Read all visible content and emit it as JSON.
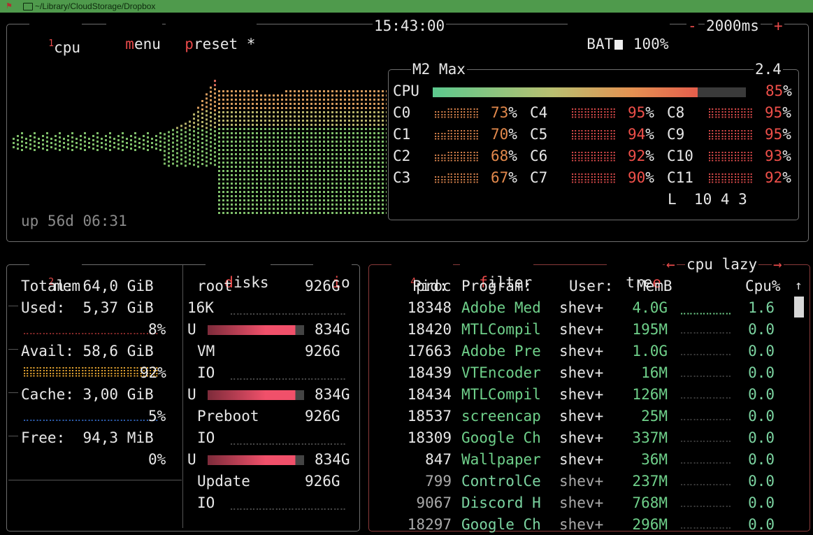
{
  "titlebar": {
    "path": "~/Library/CloudStorage/Dropbox"
  },
  "cpu": {
    "num": "1",
    "label": "cpu",
    "menu_first": "m",
    "menu_rest": "enu",
    "preset_first": "p",
    "preset_rest": "reset *",
    "clock": "15:43:00",
    "battery": "BAT",
    "battery_pct": "100%",
    "minus": "-",
    "interval": "2000ms",
    "plus": "+",
    "uptime": "up 56d 06:31",
    "model": "M2 Max",
    "freq": "2.4",
    "total_label": "CPU",
    "total_pct": "85",
    "total_fraction": 0.85,
    "cores": [
      {
        "name": "C0",
        "pct": "73",
        "level": "o"
      },
      {
        "name": "C1",
        "pct": "70",
        "level": "o"
      },
      {
        "name": "C2",
        "pct": "68",
        "level": "o"
      },
      {
        "name": "C3",
        "pct": "67",
        "level": "o"
      },
      {
        "name": "C4",
        "pct": "95",
        "level": "r"
      },
      {
        "name": "C5",
        "pct": "94",
        "level": "r"
      },
      {
        "name": "C6",
        "pct": "92",
        "level": "r"
      },
      {
        "name": "C7",
        "pct": "90",
        "level": "r"
      },
      {
        "name": "C8",
        "pct": "95",
        "level": "r"
      },
      {
        "name": "C9",
        "pct": "95",
        "level": "r"
      },
      {
        "name": "C10",
        "pct": "93",
        "level": "r"
      },
      {
        "name": "C11",
        "pct": "92",
        "level": "r"
      }
    ],
    "pct_sign": "%",
    "load": "L  10 4 3",
    "colors": {
      "green": "#6fd08a",
      "orange": "#e3894c",
      "red": "#f0504a"
    }
  },
  "mem": {
    "num": "2",
    "label": "mem",
    "total": "Total: 64,0 GiB",
    "used": "Used:  5,37 GiB",
    "used_pct": "8%",
    "avail": "Avail: 58,6 GiB",
    "avail_pct": "92%",
    "cache": "Cache: 3,00 GiB",
    "cache_pct": "5%",
    "free": "Free:  94,3 MiB",
    "free_pct": "0%"
  },
  "disks": {
    "label_first": "d",
    "label_rest": "isks",
    "io_first": "i",
    "io_rest": "o",
    "root": "root",
    "root_size": "926G",
    "root_io": "16K",
    "u": "U",
    "used_size": "834G",
    "vm": "VM",
    "vm_size": "926G",
    "io": "IO",
    "preboot": "Preboot",
    "preboot_size": "926G",
    "update": "Update",
    "update_size": "926G"
  },
  "proc": {
    "num": "4",
    "label": "proc",
    "filter_first": "f",
    "filter_rest": "ilter",
    "tree_rest": "tre",
    "tree_last": "e",
    "left_arrow": "←",
    "sort": "cpu lazy",
    "right_arrow": "→",
    "headers": {
      "pid": "Pid:",
      "program": "Program:",
      "user": "User:",
      "mem": "MemB",
      "cpu": "Cpu%",
      "arrow": "↑"
    },
    "rows": [
      {
        "pid": "18348",
        "program": "Adobe Med",
        "user": "shev+",
        "mem": "4.0G",
        "cpu": "1.6"
      },
      {
        "pid": "18420",
        "program": "MTLCompil",
        "user": "shev+",
        "mem": "195M",
        "cpu": "0.0"
      },
      {
        "pid": "17663",
        "program": "Adobe Pre",
        "user": "shev+",
        "mem": "1.0G",
        "cpu": "0.0"
      },
      {
        "pid": "18439",
        "program": "VTEncoder",
        "user": "shev+",
        "mem": "16M",
        "cpu": "0.0"
      },
      {
        "pid": "18434",
        "program": "MTLCompil",
        "user": "shev+",
        "mem": "126M",
        "cpu": "0.0"
      },
      {
        "pid": "18537",
        "program": "screencap",
        "user": "shev+",
        "mem": "25M",
        "cpu": "0.0"
      },
      {
        "pid": "18309",
        "program": "Google Ch",
        "user": "shev+",
        "mem": "337M",
        "cpu": "0.0"
      },
      {
        "pid": "847",
        "program": "Wallpaper",
        "user": "shev+",
        "mem": "36M",
        "cpu": "0.0"
      },
      {
        "pid": "799",
        "program": "ControlCe",
        "user": "shev+",
        "mem": "237M",
        "cpu": "0.0"
      },
      {
        "pid": "9067",
        "program": "Discord H",
        "user": "shev+",
        "mem": "768M",
        "cpu": "0.0"
      },
      {
        "pid": "18297",
        "program": "Google Ch",
        "user": "shev+",
        "mem": "296M",
        "cpu": "0.0"
      }
    ]
  }
}
